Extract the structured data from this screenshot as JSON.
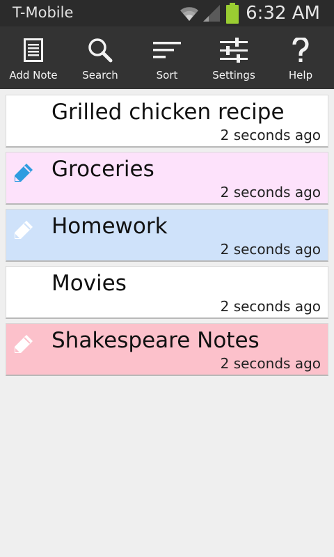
{
  "status_bar": {
    "carrier": "T-Mobile",
    "time": "6:32 AM",
    "battery_color": "#9acd32"
  },
  "toolbar": {
    "items": [
      {
        "label": "Add Note",
        "icon": "note-icon"
      },
      {
        "label": "Search",
        "icon": "search-icon"
      },
      {
        "label": "Sort",
        "icon": "sort-icon"
      },
      {
        "label": "Settings",
        "icon": "sliders-icon"
      },
      {
        "label": "Help",
        "icon": "question-icon"
      }
    ]
  },
  "notes": [
    {
      "title": "Grilled chicken recipe",
      "time": "2 seconds ago",
      "color": "#ffffff",
      "icon": "none"
    },
    {
      "title": "Groceries",
      "time": "2 seconds ago",
      "color": "#fde2fb",
      "icon": "pencil-icon",
      "icon_color": "#2e9ce0"
    },
    {
      "title": "Homework",
      "time": "2 seconds ago",
      "color": "#cfe2fa",
      "icon": "pencil-icon",
      "icon_color": "#ffffff"
    },
    {
      "title": "Movies",
      "time": "2 seconds ago",
      "color": "#ffffff",
      "icon": "none"
    },
    {
      "title": "Shakespeare Notes",
      "time": "2 seconds ago",
      "color": "#fcc1cb",
      "icon": "pencil-icon",
      "icon_color": "#ffffff"
    }
  ]
}
